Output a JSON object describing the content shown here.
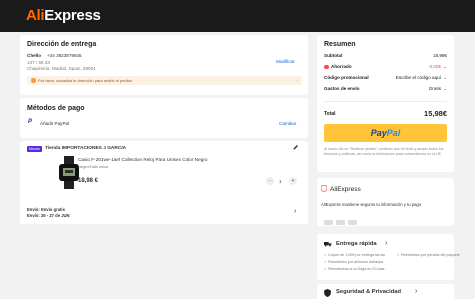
{
  "header": {
    "logo_prefix": "Ali",
    "logo_suffix": "Express"
  },
  "address": {
    "title": "Dirección de entrega",
    "name": "Chello",
    "phone": "+34 3923879845",
    "line1": "137 / 56 23",
    "line2": "Chapinería, Madrid, Spain, 28001",
    "modify": "Modificar",
    "notice": "Por favor, actualiza tu dirección para recibir el pedido"
  },
  "payment": {
    "title": "Métodos de pago",
    "method": "Añadir PayPal",
    "change": "Cambiar"
  },
  "store": {
    "badge": "Minuto",
    "name": "Tienda IMPORTACIONES J GARCIA",
    "product_title": "Casio F-201we-1aef Collection Reloj Para Unisex Color Negro",
    "variant": "Negro/Talla única",
    "price": "18,98 €",
    "quantity": "1",
    "minus": "−",
    "plus": "+",
    "shipping": "Envío: Envío gratis",
    "eta": "Envío: 25 - 27 de JUN"
  },
  "summary": {
    "title": "Resumen",
    "rows": [
      {
        "label": "Subtotal",
        "value": "18,98€"
      },
      {
        "label": "Ahorrado",
        "value": "-3,00€"
      },
      {
        "label": "Código promocional",
        "value": "Escribe el código aquí"
      },
      {
        "label": "Gastos de envío",
        "value": "Gratis"
      }
    ],
    "total_label": "Total",
    "total_value": "15,98€",
    "paypal_1": "Pay",
    "paypal_2": "Pal",
    "fine_print": "Al hacer clic en \"Realizar pedido\", confirmo que he leído y acepto todos los términos y políticas, así como la información para consumidores en la UE."
  },
  "trust": {
    "logo": "AliExpress",
    "text": "AliExpress mantiene seguros tu información y tu pago"
  },
  "fast_delivery": {
    "title": "Entrega rápida",
    "b1": "Cupón de 1,00€ por entrega tardía",
    "b2": "Reembolso por pérdida del paquete",
    "b3": "Reembolso por artículos dañados",
    "b4": "Reembolsos si no llega en 20 días"
  },
  "security": {
    "title": "Seguridad & Privacidad"
  },
  "colors": {
    "accent": "#ff4747",
    "link": "#1a5fd6",
    "paypal_yellow": "#ffc439"
  }
}
